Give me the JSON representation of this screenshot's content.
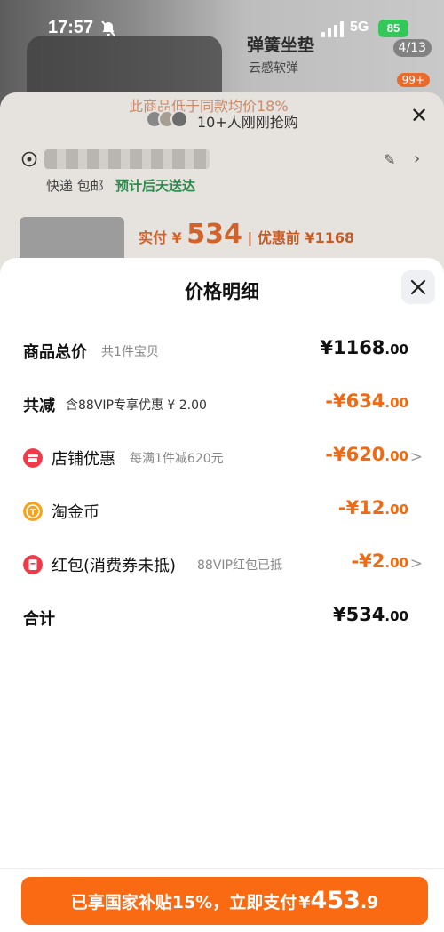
{
  "status_bar": {
    "time": "17:57",
    "network": "5G",
    "battery": "85"
  },
  "background": {
    "promo_title": "弹簧坐垫",
    "promo_subtitle": "云感软弹",
    "image_counter": "4/13",
    "badge": "99+",
    "banner": "此商品低于同款均价18%",
    "rush_text": "10+人刚刚抢购",
    "shipping": "快递 包邮",
    "delivery": "预计后天送达",
    "pay_label": "实付 ¥",
    "pay_amount": "534",
    "before_discount": "| 优惠前 ¥1168"
  },
  "sheet": {
    "title": "价格明细",
    "rows": [
      {
        "label": "商品总价",
        "sub": "共1件宝贝",
        "value_main": "¥1168",
        "value_cents": ".00"
      },
      {
        "label": "共减",
        "sub": "含88VIP专享优惠 ¥ 2.00",
        "value_main": "-¥634",
        "value_cents": ".00"
      },
      {
        "label": "店铺优惠",
        "sub": "每满1件减620元",
        "value_main": "-¥620",
        "value_cents": ".00",
        "icon": "store-coupon-icon"
      },
      {
        "label": "淘金币",
        "sub": "",
        "value_main": "-¥12",
        "value_cents": ".00",
        "icon": "gold-coin-icon"
      },
      {
        "label": "红包(消费券未抵)",
        "sub": "88VIP红包已抵",
        "value_main": "-¥2",
        "value_cents": ".00",
        "icon": "red-packet-icon"
      },
      {
        "label": "合计",
        "sub": "",
        "value_main": "¥534",
        "value_cents": ".00"
      }
    ]
  },
  "pay_button": {
    "text": "已享国家补贴15%，立即支付",
    "yen": "¥",
    "amount_int": "453",
    "amount_dec": ".9"
  },
  "colors": {
    "accent": "#f06a14",
    "button": "#fa6a12",
    "battery": "#34c759"
  }
}
